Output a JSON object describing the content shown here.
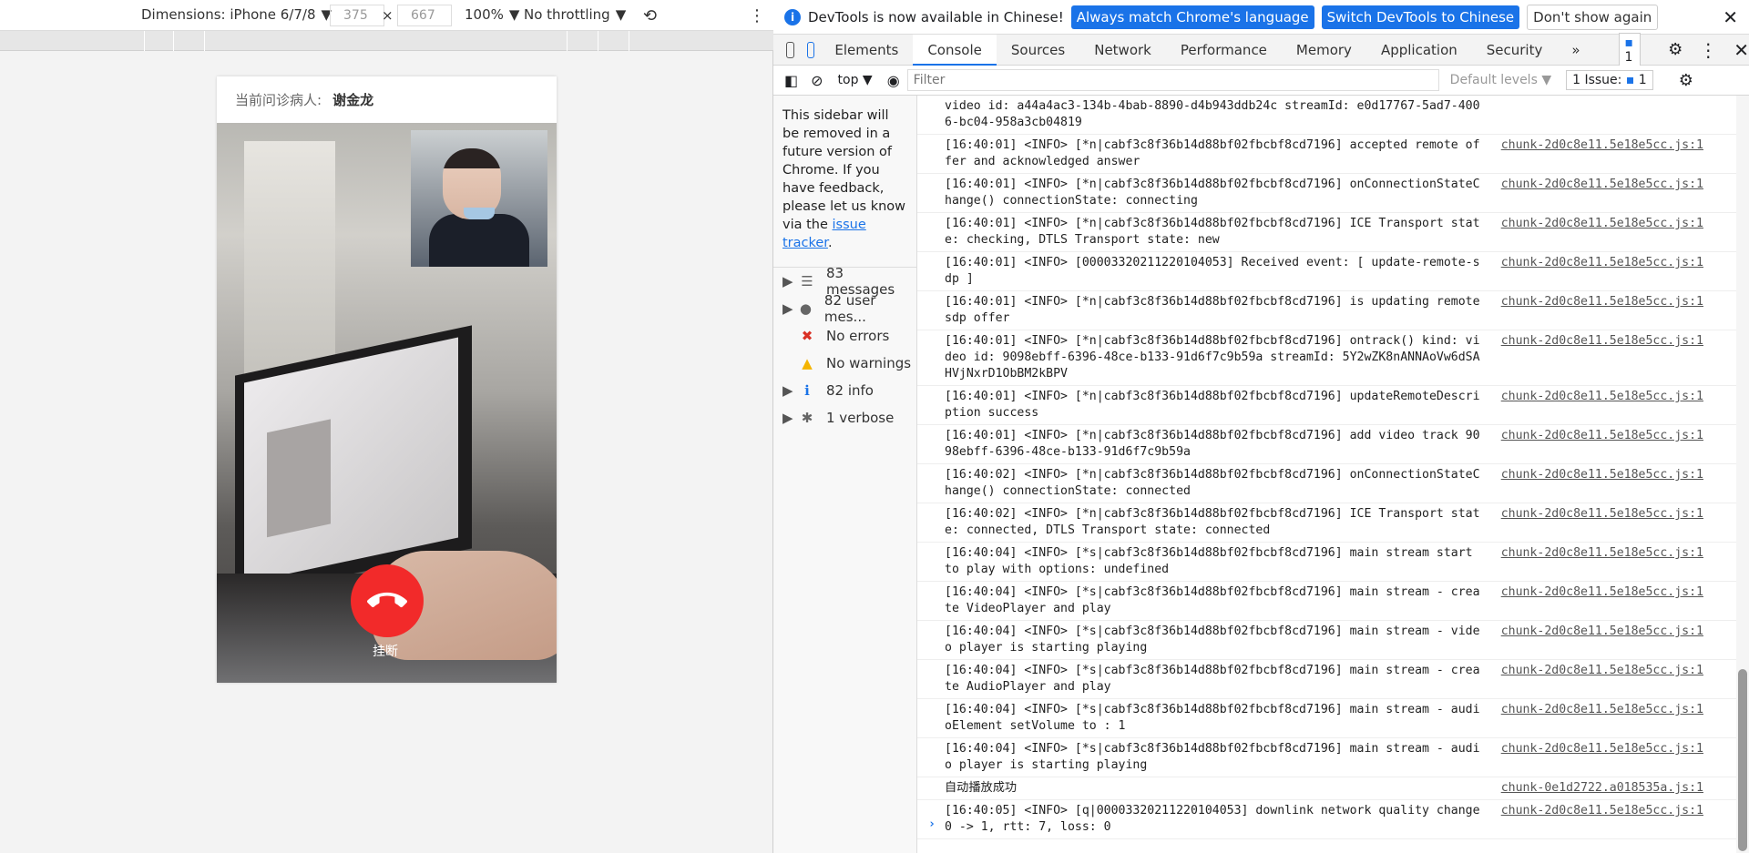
{
  "device_toolbar": {
    "dimensions_label": "Dimensions: iPhone 6/7/8",
    "width": "375",
    "height": "667",
    "times": "×",
    "zoom": "100%",
    "throttling": "No throttling"
  },
  "mobile_page": {
    "patient_label": "当前问诊病人:",
    "patient_name": "谢金龙",
    "hangup_label": "挂断"
  },
  "infobar": {
    "text": "DevTools is now available in Chinese!",
    "btn_match": "Always match Chrome's language",
    "btn_switch": "Switch DevTools to Chinese",
    "btn_dont": "Don't show again"
  },
  "tabs": [
    "Elements",
    "Console",
    "Sources",
    "Network",
    "Performance",
    "Memory",
    "Application",
    "Security"
  ],
  "tab_more": "»",
  "issue_badge": "1",
  "filter": {
    "context": "top",
    "placeholder": "Filter",
    "levels": "Default levels",
    "issues_label": "1 Issue:",
    "issues_count": "1"
  },
  "sidebar": {
    "notice_prefix": "This sidebar will be removed in a future version of Chrome. If you have feedback, please let us know via the",
    "link": "issue tracker",
    "period": ".",
    "items": [
      {
        "label": "83 messages",
        "has_caret": true,
        "icon": "list-icon"
      },
      {
        "label": "82 user mes...",
        "has_caret": true,
        "icon": "user-icon"
      },
      {
        "label": "No errors",
        "has_caret": false,
        "icon": "error-icon"
      },
      {
        "label": "No warnings",
        "has_caret": false,
        "icon": "warning-icon"
      },
      {
        "label": "82 info",
        "has_caret": true,
        "icon": "info-icon"
      },
      {
        "label": "1 verbose",
        "has_caret": true,
        "icon": "bug-icon"
      }
    ]
  },
  "console_rows": [
    {
      "msg": "video id: a44a4ac3-134b-4bab-8890-d4b943ddb24c streamId: e0d17767-5ad7-4006-bc04-958a3cb04819",
      "src": ""
    },
    {
      "msg": "[16:40:01] <INFO> [*n|cabf3c8f36b14d88bf02fbcbf8cd7196]  accepted remote offer and acknowledged answer",
      "src": "chunk-2d0c8e11.5e18e5cc.js:1"
    },
    {
      "msg": "[16:40:01] <INFO> [*n|cabf3c8f36b14d88bf02fbcbf8cd7196] onConnectionStateChange() connectionState: connecting",
      "src": "chunk-2d0c8e11.5e18e5cc.js:1"
    },
    {
      "msg": "[16:40:01] <INFO> [*n|cabf3c8f36b14d88bf02fbcbf8cd7196]  ICE Transport state: checking, DTLS Transport state: new",
      "src": "chunk-2d0c8e11.5e18e5cc.js:1"
    },
    {
      "msg": "[16:40:01] <INFO> [00003320211220104053] Received event: [ update-remote-sdp ]",
      "src": "chunk-2d0c8e11.5e18e5cc.js:1"
    },
    {
      "msg": "[16:40:01] <INFO> [*n|cabf3c8f36b14d88bf02fbcbf8cd7196]  is updating remote sdp offer",
      "src": "chunk-2d0c8e11.5e18e5cc.js:1"
    },
    {
      "msg": "[16:40:01] <INFO> [*n|cabf3c8f36b14d88bf02fbcbf8cd7196]  ontrack() kind: video id: 9098ebff-6396-48ce-b133-91d6f7c9b59a streamId: 5Y2wZK8nANNAoVw6dSAHVjNxrD1ObBM2kBPV",
      "src": "chunk-2d0c8e11.5e18e5cc.js:1"
    },
    {
      "msg": "[16:40:01] <INFO> [*n|cabf3c8f36b14d88bf02fbcbf8cd7196] updateRemoteDescription success",
      "src": "chunk-2d0c8e11.5e18e5cc.js:1"
    },
    {
      "msg": "[16:40:01] <INFO> [*n|cabf3c8f36b14d88bf02fbcbf8cd7196]  add video track 9098ebff-6396-48ce-b133-91d6f7c9b59a",
      "src": "chunk-2d0c8e11.5e18e5cc.js:1"
    },
    {
      "msg": "[16:40:02] <INFO> [*n|cabf3c8f36b14d88bf02fbcbf8cd7196] onConnectionStateChange() connectionState: connected",
      "src": "chunk-2d0c8e11.5e18e5cc.js:1"
    },
    {
      "msg": "[16:40:02] <INFO> [*n|cabf3c8f36b14d88bf02fbcbf8cd7196]  ICE Transport state: connected, DTLS Transport state: connected",
      "src": "chunk-2d0c8e11.5e18e5cc.js:1"
    },
    {
      "msg": "[16:40:04] <INFO> [*s|cabf3c8f36b14d88bf02fbcbf8cd7196] main stream start to play with options: undefined",
      "src": "chunk-2d0c8e11.5e18e5cc.js:1"
    },
    {
      "msg": "[16:40:04] <INFO> [*s|cabf3c8f36b14d88bf02fbcbf8cd7196] main stream - create VideoPlayer and play",
      "src": "chunk-2d0c8e11.5e18e5cc.js:1"
    },
    {
      "msg": "[16:40:04] <INFO> [*s|cabf3c8f36b14d88bf02fbcbf8cd7196] main stream - video player is starting playing",
      "src": "chunk-2d0c8e11.5e18e5cc.js:1"
    },
    {
      "msg": "[16:40:04] <INFO> [*s|cabf3c8f36b14d88bf02fbcbf8cd7196] main stream - create AudioPlayer and play",
      "src": "chunk-2d0c8e11.5e18e5cc.js:1"
    },
    {
      "msg": "[16:40:04] <INFO> [*s|cabf3c8f36b14d88bf02fbcbf8cd7196] main stream - audioElement setVolume to : 1",
      "src": "chunk-2d0c8e11.5e18e5cc.js:1"
    },
    {
      "msg": "[16:40:04] <INFO> [*s|cabf3c8f36b14d88bf02fbcbf8cd7196] main stream - audio player is starting playing",
      "src": "chunk-2d0c8e11.5e18e5cc.js:1"
    },
    {
      "msg": "自动播放成功",
      "src": "chunk-0e1d2722.a018535a.js:1"
    },
    {
      "msg": "[16:40:05] <INFO> [q|00003320211220104053]  downlink network quality change 0 -> 1, rtt: 7, loss: 0",
      "src": "chunk-2d0c8e11.5e18e5cc.js:1"
    }
  ],
  "prompt": "›"
}
